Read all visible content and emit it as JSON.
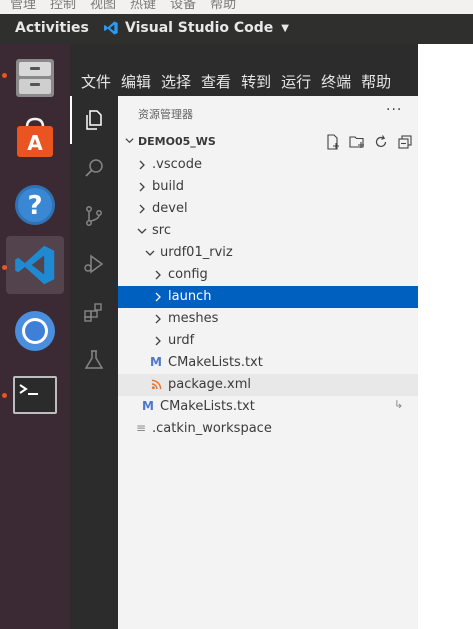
{
  "host_menu": {
    "items": [
      "管理",
      "控制",
      "视图",
      "热键",
      "设备",
      "帮助"
    ]
  },
  "topbar": {
    "activities": "Activities",
    "app_name": "Visual Studio Code"
  },
  "dock": {
    "items": [
      {
        "name": "files",
        "icon": "file-cabinet-icon",
        "running": true
      },
      {
        "name": "software",
        "icon": "shopping-bag-icon",
        "running": false
      },
      {
        "name": "help",
        "icon": "question-icon",
        "running": false
      },
      {
        "name": "vscode",
        "icon": "vscode-icon",
        "running": true,
        "active": true
      },
      {
        "name": "chromium",
        "icon": "chromium-icon",
        "running": false
      },
      {
        "name": "terminal",
        "icon": "terminal-icon",
        "running": true
      }
    ]
  },
  "menubar": {
    "items": [
      "文件",
      "编辑",
      "选择",
      "查看",
      "转到",
      "运行",
      "终端",
      "帮助"
    ]
  },
  "activitybar": {
    "items": [
      "explorer-icon",
      "search-icon",
      "source-control-icon",
      "run-debug-icon",
      "extensions-icon",
      "testing-icon"
    ]
  },
  "sidebar": {
    "title": "资源管理器",
    "more": "···",
    "workspace": "DEMO05_WS",
    "tree": [
      {
        "label": ".vscode",
        "type": "folder",
        "expanded": false,
        "depth": 1
      },
      {
        "label": "build",
        "type": "folder",
        "expanded": false,
        "depth": 1
      },
      {
        "label": "devel",
        "type": "folder",
        "expanded": false,
        "depth": 1
      },
      {
        "label": "src",
        "type": "folder",
        "expanded": true,
        "depth": 1
      },
      {
        "label": "urdf01_rviz",
        "type": "folder",
        "expanded": true,
        "depth": 2
      },
      {
        "label": "config",
        "type": "folder",
        "expanded": false,
        "depth": 3
      },
      {
        "label": "launch",
        "type": "folder",
        "expanded": false,
        "depth": 3,
        "selected": true
      },
      {
        "label": "meshes",
        "type": "folder",
        "expanded": false,
        "depth": 3
      },
      {
        "label": "urdf",
        "type": "folder",
        "expanded": false,
        "depth": 3
      },
      {
        "label": "CMakeLists.txt",
        "type": "cmake",
        "depth": 3,
        "icon_text": "M"
      },
      {
        "label": "package.xml",
        "type": "xml",
        "depth": 3,
        "hover": true,
        "icon_text": "ʅ"
      },
      {
        "label": "CMakeLists.txt",
        "type": "cmake",
        "depth": 2,
        "icon_text": "M",
        "symlink": true
      },
      {
        "label": ".catkin_workspace",
        "type": "file",
        "depth": 1,
        "icon_text": "≡"
      }
    ]
  },
  "colors": {
    "selected": "#0060c0",
    "dock_bg": "#3b2a34",
    "vscode_dark": "#2c2c2c",
    "accent": "#e95420"
  }
}
